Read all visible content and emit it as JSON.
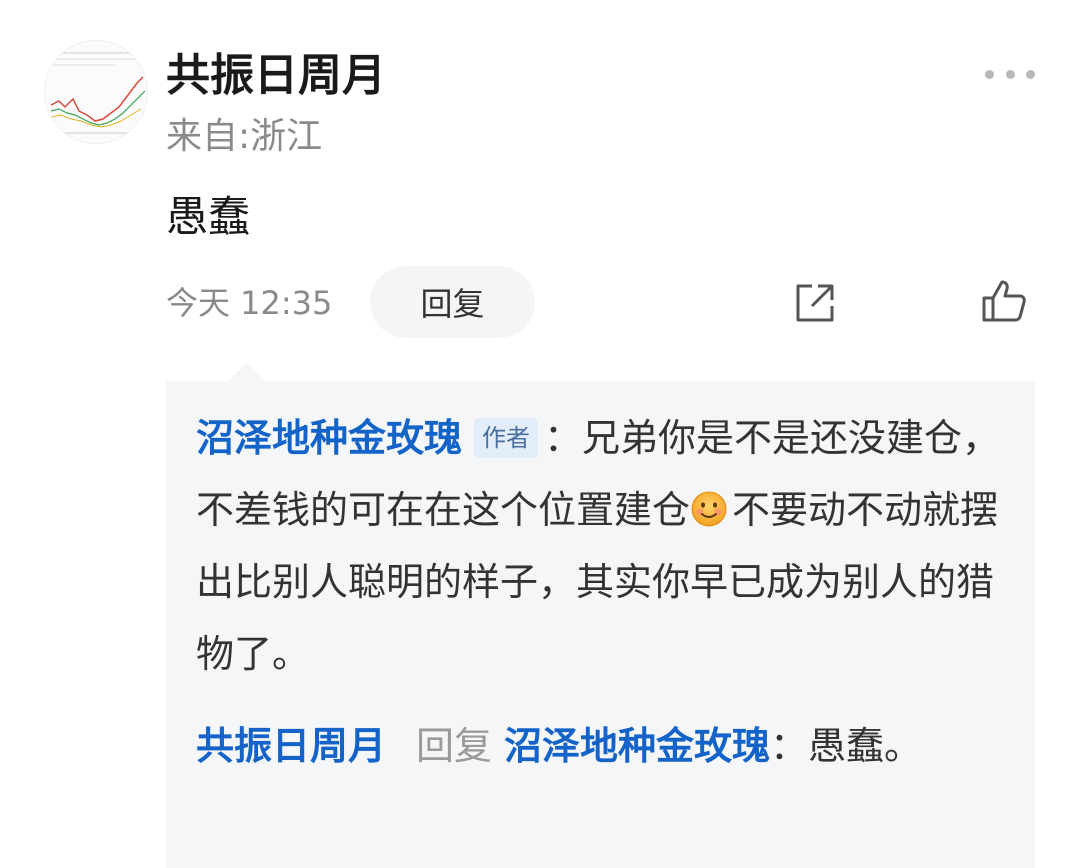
{
  "post": {
    "username": "共振日周月",
    "location": "来自:浙江",
    "comment": "愚蠢",
    "time": "今天 12:35",
    "reply_label": "回复"
  },
  "icons": {
    "more": "more-dots-icon",
    "share": "share-icon",
    "like": "thumbs-up-icon",
    "emoji": "smile-emoji-icon"
  },
  "thread": {
    "items": [
      {
        "author": "沼泽地种金玫瑰",
        "badge": "作者",
        "text_before_emoji": "：兄弟你是不是还没建仓，不差钱的可在在这个位置建仓",
        "text_after_emoji": "不要动不动就摆出比别人聪明的样子，其实你早已成为别人的猎物了。"
      },
      {
        "author": "共振日周月",
        "reply_word": "回复",
        "reply_to": "沼泽地种金玫瑰",
        "text": "：愚蠢。"
      }
    ]
  },
  "colors": {
    "link_blue": "#1463c8",
    "thread_bg": "#f5f6f7",
    "secondary_text": "#8a8a8a",
    "badge_bg": "#e3edf9"
  }
}
